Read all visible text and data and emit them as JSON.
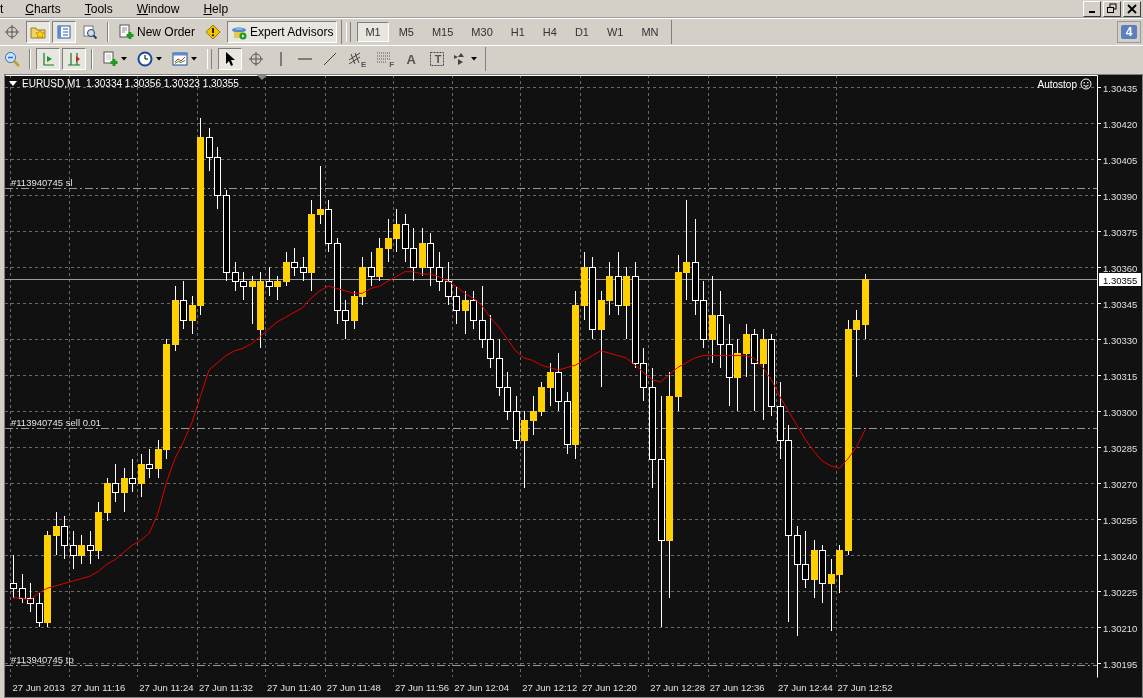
{
  "menu": [
    {
      "label": "t",
      "underline": false
    },
    {
      "label": "Charts",
      "underline": true
    },
    {
      "label": "Tools",
      "underline": true
    },
    {
      "label": "Window",
      "underline": true
    },
    {
      "label": "Help",
      "underline": true
    }
  ],
  "window_controls": [
    {
      "kind": "minimize"
    },
    {
      "kind": "restore"
    },
    {
      "kind": "close"
    }
  ],
  "toolbar_1": [
    {
      "kind": "crosshair",
      "selected": false
    },
    {
      "kind": "favorites",
      "selected": true
    },
    {
      "kind": "navigator",
      "selected": true
    },
    {
      "kind": "tester",
      "selected": false
    },
    {
      "kind": "separator"
    },
    {
      "kind": "neworder",
      "label": "New Order",
      "selected": false
    },
    {
      "kind": "alert",
      "selected": false
    },
    {
      "kind": "experts",
      "label": "Expert Advisors",
      "selected": true
    }
  ],
  "timeframes": [
    {
      "label": "M1",
      "selected": true
    },
    {
      "label": "M5",
      "selected": false
    },
    {
      "label": "M15",
      "selected": false
    },
    {
      "label": "M30",
      "selected": false
    },
    {
      "label": "H1",
      "selected": false
    },
    {
      "label": "H4",
      "selected": false
    },
    {
      "label": "D1",
      "selected": false
    },
    {
      "label": "W1",
      "selected": false
    },
    {
      "label": "MN",
      "selected": false
    }
  ],
  "notifications": {
    "count": "4"
  },
  "toolbar_2": [
    {
      "kind": "zoomout",
      "selected": false
    },
    {
      "kind": "separator"
    },
    {
      "kind": "autoscroll",
      "selected": true
    },
    {
      "kind": "chartshift",
      "selected": true
    },
    {
      "kind": "separator"
    },
    {
      "kind": "newchart",
      "selected": false,
      "dropdown": true
    },
    {
      "kind": "periods",
      "selected": false,
      "dropdown": true
    },
    {
      "kind": "templates",
      "selected": false,
      "dropdown": true
    },
    {
      "kind": "grip"
    },
    {
      "kind": "cursor",
      "selected": true
    },
    {
      "kind": "crosshair",
      "selected": false
    },
    {
      "kind": "vline",
      "selected": false
    },
    {
      "kind": "hline",
      "selected": false
    },
    {
      "kind": "trendline",
      "selected": false
    },
    {
      "kind": "channel",
      "label": "E",
      "selected": false
    },
    {
      "kind": "fibo",
      "label": "F",
      "selected": false
    },
    {
      "kind": "text",
      "label": "A",
      "selected": false
    },
    {
      "kind": "textlabel",
      "label": "T",
      "selected": false
    },
    {
      "kind": "arrows",
      "selected": false,
      "dropdown": true
    }
  ],
  "chart": {
    "symbol": "EURUSD,M1",
    "ohlc": "1.30334 1.30356 1.30323 1.30355",
    "status": "Autostop",
    "chart_data": {
      "type": "candlestick",
      "grid": true,
      "ylim": [
        1.30189,
        1.3044
      ],
      "yticks": [
        {
          "value": 1.30195,
          "label": "1.30195"
        },
        {
          "value": 1.3021,
          "label": "1.30210"
        },
        {
          "value": 1.30225,
          "label": "1.30225"
        },
        {
          "value": 1.3024,
          "label": "1.30240"
        },
        {
          "value": 1.30255,
          "label": "1.30255"
        },
        {
          "value": 1.3027,
          "label": "1.30270"
        },
        {
          "value": 1.30285,
          "label": "1.30285"
        },
        {
          "value": 1.303,
          "label": "1.30300"
        },
        {
          "value": 1.30315,
          "label": "1.30315"
        },
        {
          "value": 1.3033,
          "label": "1.30330"
        },
        {
          "value": 1.30345,
          "label": "1.30345"
        },
        {
          "value": 1.3036,
          "label": "1.30360"
        },
        {
          "value": 1.30375,
          "label": "1.30375"
        },
        {
          "value": 1.3039,
          "label": "1.30390"
        },
        {
          "value": 1.30405,
          "label": "1.30405"
        },
        {
          "value": 1.3042,
          "label": "1.30420"
        },
        {
          "value": 1.30435,
          "label": "1.30435"
        }
      ],
      "categories": [
        null,
        null,
        null,
        "27 Jun 2013",
        null,
        null,
        null,
        null,
        null,
        null,
        "27 Jun 11:16",
        null,
        null,
        null,
        null,
        null,
        null,
        null,
        "27 Jun 11:24",
        null,
        null,
        null,
        null,
        null,
        null,
        "27 Jun 11:32",
        null,
        null,
        null,
        null,
        null,
        null,
        null,
        "27 Jun 11:40",
        null,
        null,
        null,
        null,
        null,
        null,
        "27 Jun 11:48",
        null,
        null,
        null,
        null,
        null,
        null,
        null,
        "27 Jun 11:56",
        null,
        null,
        null,
        null,
        null,
        null,
        "27 Jun 12:04",
        null,
        null,
        null,
        null,
        null,
        null,
        null,
        "27 Jun 12:12",
        null,
        null,
        null,
        null,
        null,
        null,
        "27 Jun 12:20",
        null,
        null,
        null,
        null,
        null,
        null,
        null,
        "27 Jun 12:28",
        null,
        null,
        null,
        null,
        null,
        null,
        "27 Jun 12:36",
        null,
        null,
        null,
        null,
        null,
        null,
        null,
        "27 Jun 12:44",
        null,
        null,
        null,
        null,
        null,
        null,
        "27 Jun 12:52"
      ],
      "ohlc": [
        [
          1.30228,
          1.3024,
          1.30222,
          1.30226
        ],
        [
          1.30226,
          1.30232,
          1.3022,
          1.30222
        ],
        [
          1.30222,
          1.30228,
          1.30216,
          1.3022
        ],
        [
          1.3022,
          1.30224,
          1.3021,
          1.30212
        ],
        [
          1.30212,
          1.3025,
          1.3021,
          1.30248
        ],
        [
          1.30248,
          1.30258,
          1.3024,
          1.30252
        ],
        [
          1.30252,
          1.30256,
          1.30238,
          1.30244
        ],
        [
          1.30244,
          1.3025,
          1.30234,
          1.3024
        ],
        [
          1.3024,
          1.30248,
          1.30236,
          1.30244
        ],
        [
          1.30244,
          1.3025,
          1.30236,
          1.30242
        ],
        [
          1.30242,
          1.30262,
          1.30238,
          1.30258
        ],
        [
          1.30258,
          1.30272,
          1.30254,
          1.3027
        ],
        [
          1.3027,
          1.30278,
          1.30262,
          1.30266
        ],
        [
          1.30266,
          1.30276,
          1.30258,
          1.30272
        ],
        [
          1.30272,
          1.3028,
          1.30266,
          1.3027
        ],
        [
          1.3027,
          1.30282,
          1.30264,
          1.30278
        ],
        [
          1.30278,
          1.30284,
          1.30272,
          1.30276
        ],
        [
          1.30276,
          1.30288,
          1.30272,
          1.30284
        ],
        [
          1.30284,
          1.3033,
          1.3028,
          1.30328
        ],
        [
          1.30328,
          1.30352,
          1.30325,
          1.30346
        ],
        [
          1.30346,
          1.30354,
          1.30334,
          1.30338
        ],
        [
          1.30338,
          1.30348,
          1.30332,
          1.30344
        ],
        [
          1.30344,
          1.30422,
          1.3034,
          1.30414
        ],
        [
          1.30414,
          1.30418,
          1.304,
          1.30406
        ],
        [
          1.30406,
          1.3041,
          1.30384,
          1.3039
        ],
        [
          1.3039,
          1.30392,
          1.30354,
          1.30358
        ],
        [
          1.30358,
          1.30362,
          1.3035,
          1.30354
        ],
        [
          1.30354,
          1.30358,
          1.30346,
          1.30352
        ],
        [
          1.30352,
          1.30356,
          1.30336,
          1.30354
        ],
        [
          1.30334,
          1.30358,
          1.30326,
          1.30354
        ],
        [
          1.30354,
          1.3036,
          1.30348,
          1.30352
        ],
        [
          1.30352,
          1.30356,
          1.30346,
          1.30354
        ],
        [
          1.30354,
          1.30366,
          1.30352,
          1.30362
        ],
        [
          1.30362,
          1.30368,
          1.30356,
          1.3036
        ],
        [
          1.3036,
          1.30364,
          1.30354,
          1.30358
        ],
        [
          1.30358,
          1.30388,
          1.3035,
          1.30382
        ],
        [
          1.30382,
          1.30402,
          1.30378,
          1.30384
        ],
        [
          1.30384,
          1.30388,
          1.30366,
          1.3037
        ],
        [
          1.3037,
          1.30372,
          1.30336,
          1.30342
        ],
        [
          1.30342,
          1.30346,
          1.3033,
          1.30338
        ],
        [
          1.30338,
          1.3035,
          1.30334,
          1.30348
        ],
        [
          1.30348,
          1.30364,
          1.30344,
          1.3036
        ],
        [
          1.3036,
          1.30366,
          1.30352,
          1.30356
        ],
        [
          1.30356,
          1.30372,
          1.30354,
          1.30368
        ],
        [
          1.30368,
          1.3038,
          1.30362,
          1.30372
        ],
        [
          1.30372,
          1.30384,
          1.30366,
          1.30378
        ],
        [
          1.30378,
          1.30382,
          1.30362,
          1.30368
        ],
        [
          1.30368,
          1.30376,
          1.30354,
          1.3036
        ],
        [
          1.3036,
          1.30376,
          1.30356,
          1.3037
        ],
        [
          1.3037,
          1.30374,
          1.30352,
          1.3036
        ],
        [
          1.3036,
          1.30366,
          1.3035,
          1.30354
        ],
        [
          1.30354,
          1.30362,
          1.30344,
          1.30348
        ],
        [
          1.30348,
          1.30352,
          1.30336,
          1.30342
        ],
        [
          1.30342,
          1.3035,
          1.30332,
          1.30346
        ],
        [
          1.30346,
          1.3035,
          1.30334,
          1.30338
        ],
        [
          1.30338,
          1.30352,
          1.30326,
          1.3033
        ],
        [
          1.3033,
          1.3034,
          1.30318,
          1.30322
        ],
        [
          1.30322,
          1.3033,
          1.30306,
          1.3031
        ],
        [
          1.3031,
          1.30316,
          1.30296,
          1.303
        ],
        [
          1.303,
          1.30306,
          1.30284,
          1.30288
        ],
        [
          1.30288,
          1.303,
          1.30268,
          1.30296
        ],
        [
          1.30296,
          1.30306,
          1.3029,
          1.303
        ],
        [
          1.303,
          1.30312,
          1.30298,
          1.3031
        ],
        [
          1.3031,
          1.3032,
          1.30302,
          1.30316
        ],
        [
          1.30316,
          1.30324,
          1.303,
          1.30304
        ],
        [
          1.30304,
          1.30308,
          1.30282,
          1.30286
        ],
        [
          1.30286,
          1.3035,
          1.3028,
          1.30344
        ],
        [
          1.30344,
          1.30366,
          1.30338,
          1.3036
        ],
        [
          1.3036,
          1.30364,
          1.3033,
          1.30334
        ],
        [
          1.30334,
          1.3035,
          1.3031,
          1.30346
        ],
        [
          1.30346,
          1.30362,
          1.3034,
          1.30356
        ],
        [
          1.30356,
          1.30366,
          1.3034,
          1.30344
        ],
        [
          1.30344,
          1.3036,
          1.3033,
          1.30356
        ],
        [
          1.30356,
          1.30362,
          1.30318,
          1.3032
        ],
        [
          1.3032,
          1.30326,
          1.30304,
          1.3031
        ],
        [
          1.3031,
          1.30318,
          1.30268,
          1.3028
        ],
        [
          1.3028,
          1.30306,
          1.3021,
          1.30246
        ],
        [
          1.30246,
          1.30316,
          1.30222,
          1.30306
        ],
        [
          1.30306,
          1.30365,
          1.303,
          1.30358
        ],
        [
          1.30358,
          1.30388,
          1.30346,
          1.30362
        ],
        [
          1.30362,
          1.3038,
          1.3034,
          1.30346
        ],
        [
          1.30346,
          1.30354,
          1.30326,
          1.3033
        ],
        [
          1.3033,
          1.30356,
          1.3032,
          1.3034
        ],
        [
          1.3034,
          1.3035,
          1.30318,
          1.30328
        ],
        [
          1.30328,
          1.30336,
          1.30302,
          1.30314
        ],
        [
          1.30314,
          1.3033,
          1.303,
          1.30324
        ],
        [
          1.30324,
          1.30336,
          1.30314,
          1.30332
        ],
        [
          1.30332,
          1.30334,
          1.303,
          1.3032
        ],
        [
          1.3032,
          1.30334,
          1.30296,
          1.3033
        ],
        [
          1.3033,
          1.30332,
          1.30298,
          1.30302
        ],
        [
          1.30302,
          1.30312,
          1.3028,
          1.30288
        ],
        [
          1.30288,
          1.30294,
          1.30212,
          1.30248
        ],
        [
          1.30248,
          1.30252,
          1.30206,
          1.30236
        ],
        [
          1.30236,
          1.3025,
          1.30226,
          1.3023
        ],
        [
          1.3023,
          1.30246,
          1.30222,
          1.30242
        ],
        [
          1.30242,
          1.30244,
          1.3022,
          1.30228
        ],
        [
          1.30228,
          1.30238,
          1.30208,
          1.30232
        ],
        [
          1.30232,
          1.30244,
          1.30224,
          1.30242
        ],
        [
          1.30242,
          1.30338,
          1.3024,
          1.30334
        ],
        [
          1.30334,
          1.30342,
          1.30314,
          1.30338
        ],
        [
          1.30336,
          1.30357,
          1.3033,
          1.30355
        ]
      ],
      "series": [
        {
          "type": "line",
          "color": "#e00000",
          "values": [
            1.30222,
            1.30222,
            1.30221,
            1.30224,
            1.30226,
            1.30227,
            1.30228,
            1.30229,
            1.3023,
            1.30231,
            1.30233,
            1.30236,
            1.30238,
            1.30241,
            1.30244,
            1.30246,
            1.30249,
            1.30257,
            1.3027,
            1.3028,
            1.30287,
            1.30295,
            1.30306,
            1.30317,
            1.3032,
            1.30323,
            1.30325,
            1.30326,
            1.30328,
            1.30331,
            1.30334,
            1.30337,
            1.30339,
            1.30341,
            1.30343,
            1.30347,
            1.3035,
            1.30352,
            1.30351,
            1.3035,
            1.30349,
            1.30349,
            1.30351,
            1.30352,
            1.30354,
            1.30356,
            1.30358,
            1.30358,
            1.30357,
            1.30357,
            1.30356,
            1.30354,
            1.30352,
            1.30349,
            1.30347,
            1.30344,
            1.30339,
            1.30335,
            1.3033,
            1.30325,
            1.30322,
            1.30321,
            1.30319,
            1.30318,
            1.30317,
            1.30318,
            1.30319,
            1.30321,
            1.30323,
            1.30325,
            1.30324,
            1.30323,
            1.30322,
            1.30319,
            1.30316,
            1.30313,
            1.30312,
            1.30315,
            1.30318,
            1.3032,
            1.30322,
            1.30323,
            1.30323,
            1.30323,
            1.30323,
            1.30323,
            1.30323,
            1.30322,
            1.30318,
            1.30313,
            1.30306,
            1.303,
            1.30294,
            1.30288,
            1.30283,
            1.30279,
            1.30277,
            1.30276,
            1.3028,
            1.30285,
            1.30292
          ]
        }
      ],
      "ref_lines": [
        {
          "axis": "y",
          "value": 1.30393,
          "label": "#113940745 sl"
        },
        {
          "axis": "y",
          "value": 1.30293,
          "label": "#113940745 sell 0.01"
        },
        {
          "axis": "y",
          "value": 1.30194,
          "label": "#113940745 tp"
        },
        {
          "axis": "y",
          "value": 1.30355,
          "label": "1.30355"
        }
      ]
    }
  }
}
